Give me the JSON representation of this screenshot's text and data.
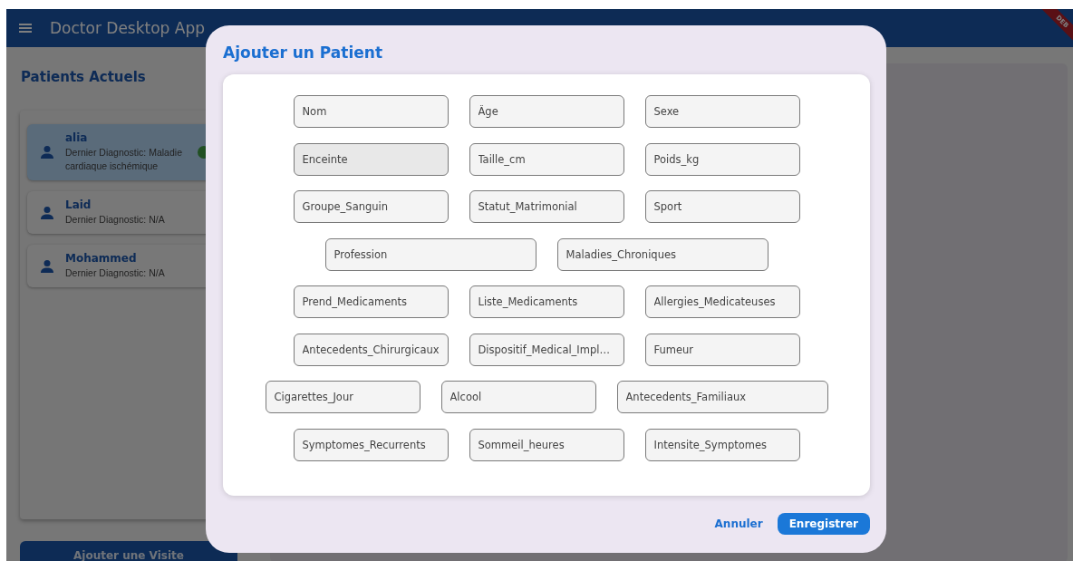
{
  "app_bar": {
    "title": "Doctor Desktop App",
    "debug_banner": "DEB"
  },
  "sidebar": {
    "title": "Patients Actuels",
    "patients": [
      {
        "name": "alia",
        "diagnosis": "Dernier Diagnostic: Maladie cardiaque ischémique",
        "selected": true,
        "verified": true
      },
      {
        "name": "Laid",
        "diagnosis": "Dernier Diagnostic: N/A",
        "selected": false,
        "verified": false
      },
      {
        "name": "Mohammed",
        "diagnosis": "Dernier Diagnostic: N/A",
        "selected": false,
        "verified": false
      }
    ],
    "add_visit_button": "Ajouter une Visite"
  },
  "dialog": {
    "title": "Ajouter un Patient",
    "field_rows": [
      [
        {
          "placeholder": "Nom",
          "highlighted": false
        },
        {
          "placeholder": "Âge",
          "highlighted": false
        },
        {
          "placeholder": "Sexe",
          "highlighted": false
        }
      ],
      [
        {
          "placeholder": "Enceinte",
          "highlighted": true
        },
        {
          "placeholder": "Taille_cm",
          "highlighted": false
        },
        {
          "placeholder": "Poids_kg",
          "highlighted": false
        }
      ],
      [
        {
          "placeholder": "Groupe_Sanguin",
          "highlighted": false
        },
        {
          "placeholder": "Statut_Matrimonial",
          "highlighted": false
        },
        {
          "placeholder": "Sport",
          "highlighted": false
        }
      ],
      [
        {
          "placeholder": "Profession",
          "highlighted": false,
          "wide": true
        },
        {
          "placeholder": "Maladies_Chroniques",
          "highlighted": false,
          "wide": true
        }
      ],
      [
        {
          "placeholder": "Prend_Medicaments",
          "highlighted": false
        },
        {
          "placeholder": "Liste_Medicaments",
          "highlighted": false
        },
        {
          "placeholder": "Allergies_Medicateuses",
          "highlighted": false
        }
      ],
      [
        {
          "placeholder": "Antecedents_Chirurgicaux",
          "highlighted": false
        },
        {
          "placeholder": "Dispositif_Medical_Impl…",
          "highlighted": false
        },
        {
          "placeholder": "Fumeur",
          "highlighted": false
        }
      ],
      [
        {
          "placeholder": "Cigarettes_Jour",
          "highlighted": false
        },
        {
          "placeholder": "Alcool",
          "highlighted": false
        },
        {
          "placeholder": "Antecedents_Familiaux",
          "highlighted": false,
          "wide": true
        }
      ],
      [
        {
          "placeholder": "Symptomes_Recurrents",
          "highlighted": false
        },
        {
          "placeholder": "Sommeil_heures",
          "highlighted": false
        },
        {
          "placeholder": "Intensite_Symptomes",
          "highlighted": false
        }
      ]
    ],
    "cancel_button": "Annuler",
    "save_button": "Enregistrer"
  }
}
